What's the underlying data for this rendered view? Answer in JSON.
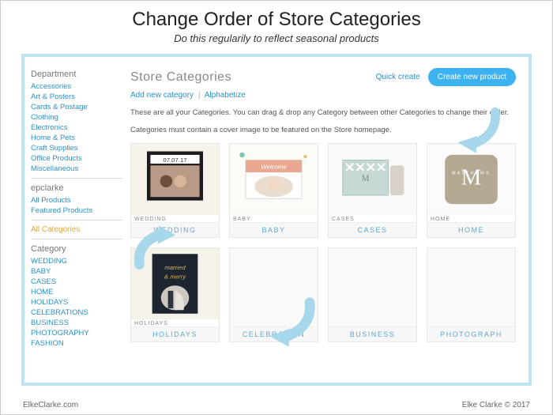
{
  "header": {
    "title": "Change Order of Store Categories",
    "subtitle": "Do this regularily to reflect seasonal products"
  },
  "sidebar": {
    "department_heading": "Department",
    "departments": [
      "Accessories",
      "Art & Posters",
      "Cards & Postage",
      "Clothing",
      "Electronics",
      "Home & Pets",
      "Craft Supplies",
      "Office Products",
      "Miscellaneous"
    ],
    "epclarke_heading": "epclarke",
    "epclarke_items": [
      "All Products",
      "Featured Products"
    ],
    "all_categories": "All Categories",
    "category_heading": "Category",
    "categories": [
      "WEDDING",
      "BABY",
      "CASES",
      "HOME",
      "HOLIDAYS",
      "CELEBRATIONS",
      "BUSINESS",
      "PHOTOGRAPHY",
      "FASHION"
    ]
  },
  "main": {
    "title": "Store Categories",
    "quick_create": "Quick create",
    "create_button": "Create new product",
    "add_new": "Add new category",
    "alphabetize": "Alphabetize",
    "desc1": "These are all your Categories. You can drag & drop any Category between other Categories to change their order.",
    "desc2": "Categories must contain a cover image to be featured on the Store homepage."
  },
  "cards": [
    {
      "cap": "WEDDING",
      "label": "WEDDING"
    },
    {
      "cap": "BABY",
      "label": "BABY"
    },
    {
      "cap": "CASES",
      "label": "CASES"
    },
    {
      "cap": "HOME",
      "label": "HOME"
    },
    {
      "cap": "HOLIDAYS",
      "label": "HOLIDAYS"
    },
    {
      "cap": "",
      "label": "CELEBRATION"
    },
    {
      "cap": "",
      "label": "BUSINESS"
    },
    {
      "cap": "",
      "label": "PHOTOGRAPH"
    }
  ],
  "footer": {
    "site": "ElkeClarke.com",
    "copyright": "Elke Clarke © 2017"
  }
}
